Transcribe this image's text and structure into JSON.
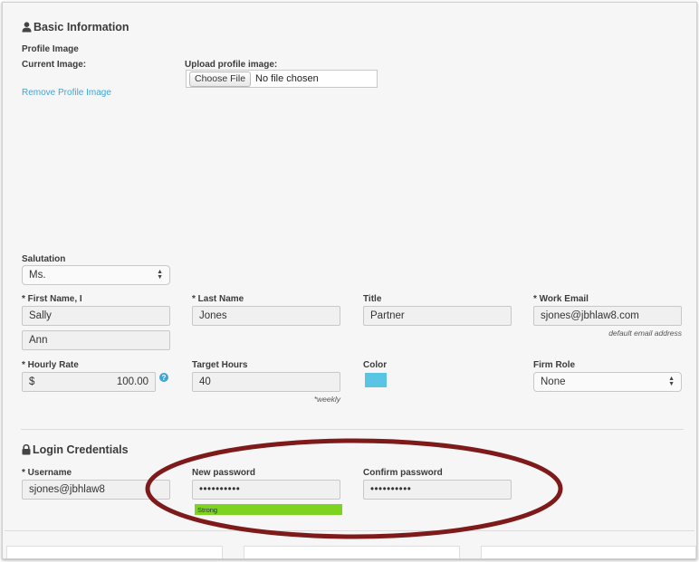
{
  "basic": {
    "section_title": "Basic Information",
    "profile_image_label": "Profile Image",
    "current_image_label": "Current Image:",
    "remove_link": "Remove Profile Image",
    "upload_label": "Upload profile image:",
    "choose_file_button": "Choose File",
    "no_file_text": "No file chosen"
  },
  "salutation": {
    "label": "Salutation",
    "value": "Ms."
  },
  "first_name": {
    "label": "* First Name, I",
    "value": "Sally",
    "middle_value": "Ann"
  },
  "last_name": {
    "label": "* Last Name",
    "value": "Jones"
  },
  "title": {
    "label": "Title",
    "value": "Partner"
  },
  "work_email": {
    "label": "* Work Email",
    "value": "sjones@jbhlaw8.com",
    "hint": "default email address"
  },
  "hourly_rate": {
    "label": "* Hourly Rate",
    "currency": "$",
    "value": "100.00",
    "help": "?"
  },
  "target_hours": {
    "label": "Target Hours",
    "value": "40",
    "hint": "*weekly"
  },
  "color": {
    "label": "Color",
    "value": "#5ac4e3"
  },
  "firm_role": {
    "label": "Firm Role",
    "value": "None"
  },
  "login": {
    "section_title": "Login Credentials",
    "username_label": "* Username",
    "username_value": "sjones@jbhlaw8",
    "new_password_label": "New password",
    "new_password_value": "••••••••••",
    "strength_text": "Strong",
    "confirm_password_label": "Confirm password",
    "confirm_password_value": "••••••••••"
  },
  "colors": {
    "accent": "#3fa5d8",
    "strength_bar": "#7ed321",
    "annotation": "#8b1a1a"
  },
  "icons": {
    "user": "user-icon",
    "lock": "lock-icon",
    "help": "help-icon",
    "select_arrows": "select-arrows-icon"
  }
}
